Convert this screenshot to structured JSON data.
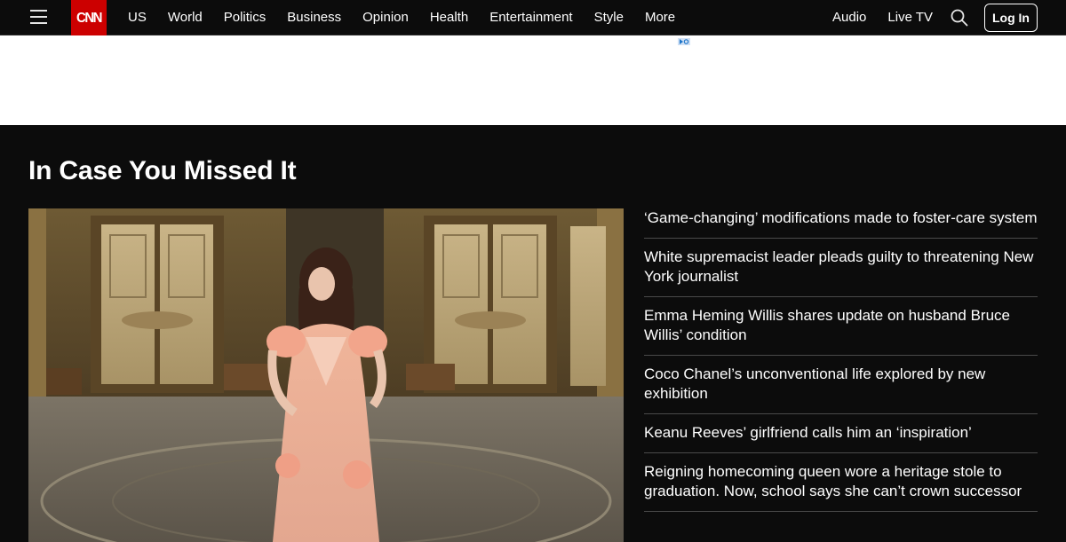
{
  "nav": {
    "logo_text": "CNN",
    "links": [
      "US",
      "World",
      "Politics",
      "Business",
      "Opinion",
      "Health",
      "Entertainment",
      "Style",
      "More"
    ],
    "audio_label": "Audio",
    "live_tv_label": "Live TV",
    "login_label": "Log In"
  },
  "section": {
    "title": "In Case You Missed It",
    "stories": [
      "‘Game-changing’ modifications made to foster-care system",
      "White supremacist leader pleads guilty to threatening New York journalist",
      "Emma Heming Willis shares update on husband Bruce Willis’ condition",
      "Coco Chanel’s unconventional life explored by new exhibition",
      "Keanu Reeves’ girlfriend calls him an ‘inspiration’",
      "Reigning homecoming queen wore a heritage stole to graduation. Now, school says she can’t crown successor"
    ]
  },
  "colors": {
    "brand_red": "#cc0000",
    "background": "#0c0c0c",
    "divider": "#4a4a4a"
  },
  "icons": {
    "menu": "hamburger-icon",
    "search": "search-icon",
    "ad": "ad-choices-icon"
  }
}
